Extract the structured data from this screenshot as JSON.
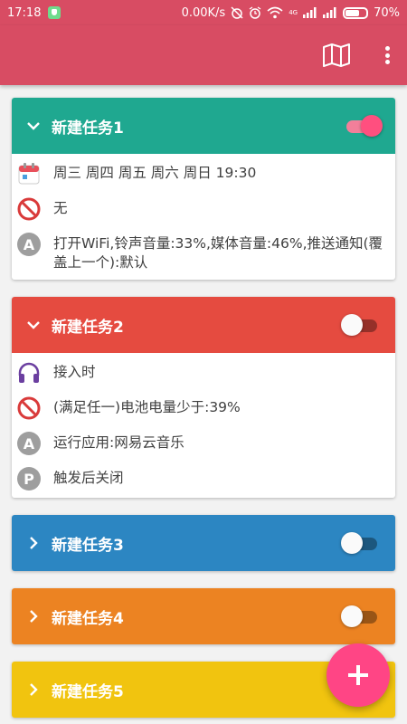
{
  "status_bar": {
    "time": "17:18",
    "network_speed": "0.00K/s",
    "network_type": "4G",
    "battery": "70%",
    "battery_level": 0.7,
    "icons": [
      "shield-icon",
      "alarm-off-icon",
      "alarm-icon",
      "wifi-icon",
      "signal-icon",
      "battery-icon"
    ]
  },
  "toolbar": {
    "background": "#d84c63",
    "actions": [
      "map-icon",
      "more-vert-icon"
    ]
  },
  "tasks": [
    {
      "title": "新建任务1",
      "color": "#1fa890",
      "expanded": true,
      "enabled": true,
      "rows": [
        {
          "icon": "calendar-icon",
          "text": "周三 周四 周五 周六 周日 19:30"
        },
        {
          "icon": "prohibited-icon",
          "text": "无"
        },
        {
          "icon": "letter-a-icon",
          "text": "打开WiFi,铃声音量:33%,媒体音量:46%,推送通知(覆盖上一个):默认"
        }
      ]
    },
    {
      "title": "新建任务2",
      "color": "#e54b40",
      "expanded": true,
      "enabled": false,
      "rows": [
        {
          "icon": "headphones-icon",
          "text": "接入时"
        },
        {
          "icon": "prohibited-icon",
          "text": "(满足任一)电池电量少于:39%"
        },
        {
          "icon": "letter-a-icon",
          "text": "运行应用:网易云音乐"
        },
        {
          "icon": "letter-p-icon",
          "text": "触发后关闭"
        }
      ]
    },
    {
      "title": "新建任务3",
      "color": "#2c86c2",
      "expanded": false,
      "enabled": false
    },
    {
      "title": "新建任务4",
      "color": "#ec8322",
      "expanded": false,
      "enabled": false
    },
    {
      "title": "新建任务5",
      "color": "#f1c40f",
      "expanded": false,
      "enabled": false
    }
  ],
  "fab": {
    "icon": "plus-icon",
    "color": "#ff4585"
  }
}
